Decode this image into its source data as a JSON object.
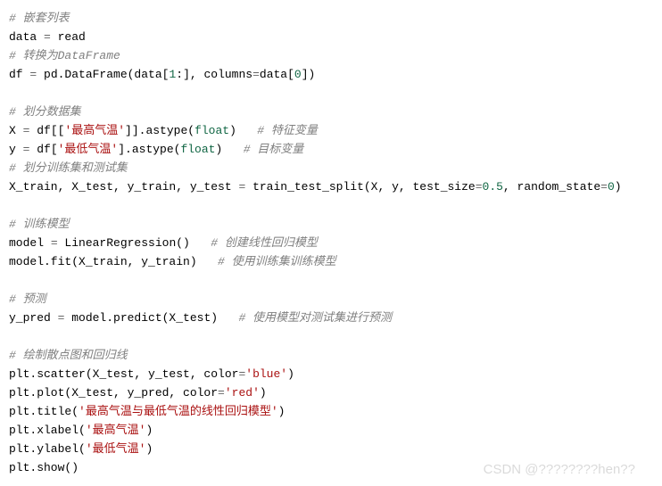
{
  "lines": {
    "c1": "# 嵌套列表",
    "l2_data": "data ",
    "l2_eq": "= ",
    "l2_read": "read",
    "c3": "# 转换为DataFrame",
    "l4_1": "df ",
    "l4_eq": "= ",
    "l4_2": "pd.DataFrame(data[",
    "l4_n1": "1",
    "l4_3": ":], columns",
    "l4_eq2": "=",
    "l4_4": "data[",
    "l4_n0": "0",
    "l4_5": "])",
    "c6": "# 划分数据集",
    "l7_1": "X ",
    "l7_eq": "= ",
    "l7_2": "df[[",
    "l7_s": "'最高气温'",
    "l7_3": "]].astype(",
    "l7_flt": "float",
    "l7_4": ")   ",
    "l7_c": "# 特征变量",
    "l8_1": "y ",
    "l8_eq": "= ",
    "l8_2": "df[",
    "l8_s": "'最低气温'",
    "l8_3": "].astype(",
    "l8_flt": "float",
    "l8_4": ")   ",
    "l8_c": "# 目标变量",
    "c9": "# 划分训练集和测试集",
    "l10_1": "X_train, X_test, y_train, y_test ",
    "l10_eq": "= ",
    "l10_2": "train_test_split(X, y, test_size",
    "l10_eq2": "=",
    "l10_n1": "0.5",
    "l10_3": ", random_state",
    "l10_eq3": "=",
    "l10_n2": "0",
    "l10_4": ")",
    "c12": "# 训练模型",
    "l13_1": "model ",
    "l13_eq": "= ",
    "l13_2": "LinearRegression()   ",
    "l13_c": "# 创建线性回归模型",
    "l14_1": "model.fit(X_train, y_train)   ",
    "l14_c": "# 使用训练集训练模型",
    "c16": "# 预测",
    "l17_1": "y_pred ",
    "l17_eq": "= ",
    "l17_2": "model.predict(X_test)   ",
    "l17_c": "# 使用模型对测试集进行预测",
    "c19": "# 绘制散点图和回归线",
    "l20_1": "plt.scatter(X_test, y_test, color",
    "l20_eq": "=",
    "l20_s": "'blue'",
    "l20_2": ")",
    "l21_1": "plt.plot(X_test, y_pred, color",
    "l21_eq": "=",
    "l21_s": "'red'",
    "l21_2": ")",
    "l22_1": "plt.title(",
    "l22_s": "'最高气温与最低气温的线性回归模型'",
    "l22_2": ")",
    "l23_1": "plt.xlabel(",
    "l23_s": "'最高气温'",
    "l23_2": ")",
    "l24_1": "plt.ylabel(",
    "l24_s": "'最低气温'",
    "l24_2": ")",
    "l25": "plt.show()"
  },
  "watermark": "CSDN @????????hen??"
}
